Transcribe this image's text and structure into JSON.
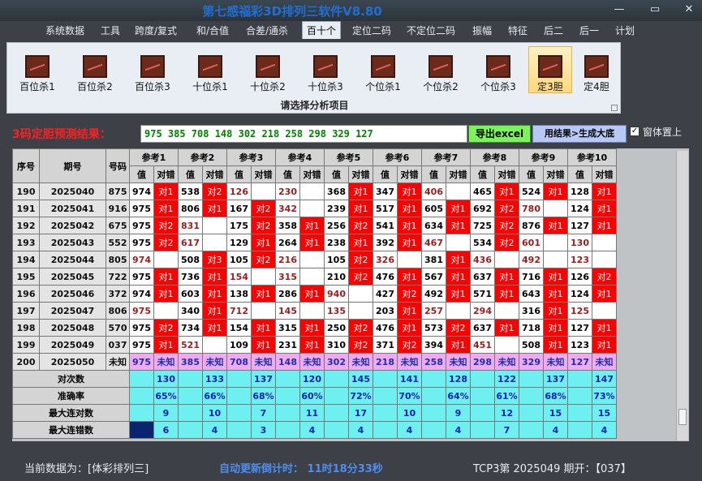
{
  "window": {
    "title": "第七感福彩3D排列三软件V8.80",
    "min": "—",
    "max": "▭",
    "close": "✕"
  },
  "menu": [
    "系统数据",
    "工具",
    "跨度/复式",
    "和/合值",
    "合差/通杀",
    "百十个",
    "定位二码",
    "不定位二码",
    "振幅",
    "特征",
    "后二",
    "后一",
    "计划"
  ],
  "menu_active": 5,
  "ribbon": {
    "items": [
      "百位杀1",
      "百位杀2",
      "百位杀3",
      "十位杀1",
      "十位杀2",
      "十位杀3",
      "个位杀1",
      "个位杀2",
      "个位杀3",
      "定3胆",
      "定4胆"
    ],
    "selected": 9,
    "caption": "请选择分析项目"
  },
  "prediction": {
    "label": "3码定胆预测结果：",
    "value": "975 385 708 148 302 218 258 298 329 127"
  },
  "buttons": {
    "excel": "导出excel",
    "generate": "用结果>生成大底"
  },
  "checkbox": {
    "label": "窗体置上",
    "checked": "✓"
  },
  "table": {
    "h_seq": "序号",
    "h_period": "期号",
    "h_code": "号码",
    "refs": [
      "参考1",
      "参考2",
      "参考3",
      "参考4",
      "参考5",
      "参考6",
      "参考7",
      "参考8",
      "参考9",
      "参考10"
    ],
    "sub_val": "值",
    "sub_res": "对错",
    "rows": [
      {
        "seq": "190",
        "period": "2025040",
        "code": "875",
        "cells": [
          [
            "974",
            "对1"
          ],
          [
            "538",
            "对2"
          ],
          [
            "126",
            ""
          ],
          [
            "230",
            ""
          ],
          [
            "368",
            "对1"
          ],
          [
            "347",
            "对1"
          ],
          [
            "406",
            ""
          ],
          [
            "465",
            "对1"
          ],
          [
            "524",
            "对1"
          ],
          [
            "128",
            "对1"
          ]
        ]
      },
      {
        "seq": "191",
        "period": "2025041",
        "code": "916",
        "cells": [
          [
            "975",
            "对1"
          ],
          [
            "806",
            "对1"
          ],
          [
            "167",
            "对2"
          ],
          [
            "342",
            ""
          ],
          [
            "239",
            "对1"
          ],
          [
            "517",
            "对1"
          ],
          [
            "605",
            "对1"
          ],
          [
            "692",
            "对2"
          ],
          [
            "780",
            ""
          ],
          [
            "124",
            "对1"
          ]
        ]
      },
      {
        "seq": "192",
        "period": "2025042",
        "code": "675",
        "cells": [
          [
            "975",
            "对2"
          ],
          [
            "831",
            ""
          ],
          [
            "175",
            "对2"
          ],
          [
            "358",
            "对1"
          ],
          [
            "256",
            "对2"
          ],
          [
            "541",
            "对1"
          ],
          [
            "634",
            "对1"
          ],
          [
            "725",
            "对2"
          ],
          [
            "876",
            "对1"
          ],
          [
            "127",
            "对1"
          ]
        ]
      },
      {
        "seq": "193",
        "period": "2025043",
        "code": "552",
        "cells": [
          [
            "975",
            "对2"
          ],
          [
            "617",
            ""
          ],
          [
            "129",
            "对1"
          ],
          [
            "264",
            "对1"
          ],
          [
            "238",
            "对1"
          ],
          [
            "392",
            "对1"
          ],
          [
            "467",
            ""
          ],
          [
            "534",
            "对2"
          ],
          [
            "601",
            ""
          ],
          [
            "130",
            ""
          ]
        ]
      },
      {
        "seq": "194",
        "period": "2025044",
        "code": "805",
        "cells": [
          [
            "974",
            ""
          ],
          [
            "508",
            "对3"
          ],
          [
            "105",
            "对2"
          ],
          [
            "216",
            ""
          ],
          [
            "105",
            "对2"
          ],
          [
            "326",
            ""
          ],
          [
            "381",
            "对1"
          ],
          [
            "436",
            ""
          ],
          [
            "492",
            ""
          ],
          [
            "123",
            ""
          ]
        ]
      },
      {
        "seq": "195",
        "period": "2025045",
        "code": "722",
        "cells": [
          [
            "975",
            "对1"
          ],
          [
            "736",
            "对1"
          ],
          [
            "154",
            ""
          ],
          [
            "315",
            ""
          ],
          [
            "210",
            "对2"
          ],
          [
            "476",
            "对1"
          ],
          [
            "567",
            "对1"
          ],
          [
            "637",
            "对1"
          ],
          [
            "716",
            "对1"
          ],
          [
            "126",
            "对2"
          ]
        ]
      },
      {
        "seq": "196",
        "period": "2025046",
        "code": "372",
        "cells": [
          [
            "974",
            "对1"
          ],
          [
            "603",
            "对1"
          ],
          [
            "138",
            "对1"
          ],
          [
            "286",
            "对1"
          ],
          [
            "940",
            ""
          ],
          [
            "427",
            "对2"
          ],
          [
            "492",
            "对1"
          ],
          [
            "571",
            "对1"
          ],
          [
            "643",
            "对1"
          ],
          [
            "124",
            "对1"
          ]
        ]
      },
      {
        "seq": "197",
        "period": "2025047",
        "code": "806",
        "cells": [
          [
            "975",
            ""
          ],
          [
            "340",
            "对1"
          ],
          [
            "712",
            ""
          ],
          [
            "145",
            ""
          ],
          [
            "135",
            ""
          ],
          [
            "203",
            "对1"
          ],
          [
            "257",
            ""
          ],
          [
            "294",
            ""
          ],
          [
            "316",
            "对1"
          ],
          [
            "125",
            ""
          ]
        ]
      },
      {
        "seq": "198",
        "period": "2025048",
        "code": "570",
        "cells": [
          [
            "975",
            "对2"
          ],
          [
            "734",
            "对1"
          ],
          [
            "154",
            "对1"
          ],
          [
            "315",
            "对1"
          ],
          [
            "250",
            "对2"
          ],
          [
            "476",
            "对1"
          ],
          [
            "573",
            "对2"
          ],
          [
            "637",
            "对1"
          ],
          [
            "718",
            "对1"
          ],
          [
            "127",
            "对1"
          ]
        ]
      },
      {
        "seq": "199",
        "period": "2025049",
        "code": "037",
        "cells": [
          [
            "975",
            "对1"
          ],
          [
            "521",
            ""
          ],
          [
            "109",
            "对1"
          ],
          [
            "231",
            "对1"
          ],
          [
            "310",
            "对2"
          ],
          [
            "371",
            "对2"
          ],
          [
            "394",
            "对1"
          ],
          [
            "451",
            ""
          ],
          [
            "508",
            "对1"
          ],
          [
            "123",
            "对1"
          ]
        ]
      },
      {
        "seq": "200",
        "period": "2025050",
        "code": "未知",
        "cells": [
          [
            "975",
            "未知"
          ],
          [
            "385",
            "未知"
          ],
          [
            "708",
            "未知"
          ],
          [
            "148",
            "未知"
          ],
          [
            "302",
            "未知"
          ],
          [
            "218",
            "未知"
          ],
          [
            "258",
            "未知"
          ],
          [
            "298",
            "未知"
          ],
          [
            "329",
            "未知"
          ],
          [
            "127",
            "未知"
          ]
        ]
      }
    ],
    "stats": [
      {
        "label": "对次数",
        "values": [
          "130",
          "133",
          "137",
          "120",
          "145",
          "141",
          "128",
          "122",
          "137",
          "147"
        ]
      },
      {
        "label": "准确率",
        "values": [
          "65%",
          "66%",
          "68%",
          "60%",
          "72%",
          "70%",
          "64%",
          "61%",
          "68%",
          "73%"
        ]
      },
      {
        "label": "最大连对数",
        "values": [
          "9",
          "10",
          "7",
          "11",
          "17",
          "10",
          "9",
          "12",
          "15",
          "15"
        ]
      },
      {
        "label": "最大连错数",
        "values": [
          "6",
          "4",
          "3",
          "4",
          "4",
          "4",
          "4",
          "7",
          "4",
          "4"
        ]
      }
    ]
  },
  "status": {
    "current": "当前数据为：[体彩排列三]",
    "countdown": "自动更新倒计时： 11时18分33秒",
    "tcp": "TCP3第 2025049 期开：【037】"
  }
}
